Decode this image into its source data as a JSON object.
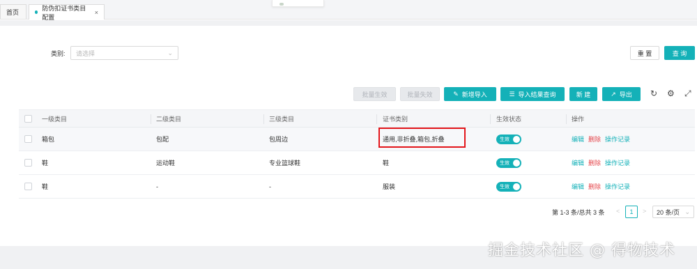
{
  "tabs": {
    "home": "首页",
    "active": "防伪扣证书类目配置",
    "close": "×"
  },
  "filter": {
    "label": "类别:",
    "placeholder": "请选择"
  },
  "buttons": {
    "reset": "重 置",
    "search": "查 询",
    "batch_enable": "批量生效",
    "batch_disable": "批量失效",
    "new_import": "新增导入",
    "import_result_query": "导入结果查询",
    "create": "新 建",
    "export": "导出"
  },
  "table": {
    "headers": [
      "一级类目",
      "二级类目",
      "三级类目",
      "证书类别",
      "生效状态",
      "操作"
    ],
    "rows": [
      {
        "level1": "箱包",
        "level2": "包配",
        "level3": "包周边",
        "cert_type": "通用,非折叠,箱包,折叠",
        "status": "生效"
      },
      {
        "level1": "鞋",
        "level2": "运动鞋",
        "level3": "专业篮球鞋",
        "cert_type": "鞋",
        "status": "生效"
      },
      {
        "level1": "鞋",
        "level2": "-",
        "level3": "-",
        "cert_type": "服装",
        "status": "生效"
      }
    ],
    "actions": {
      "edit": "编辑",
      "delete": "删除",
      "log": "操作记录"
    }
  },
  "pagination": {
    "total": "第 1-3 条/总共 3 条",
    "current_page": "1",
    "page_size": "20 条/页"
  },
  "watermark": "掘金技术社区 @ 得物技术",
  "colors": {
    "accent": "#14b1b8",
    "danger": "#e5484d",
    "highlight_border": "#e3151a"
  }
}
